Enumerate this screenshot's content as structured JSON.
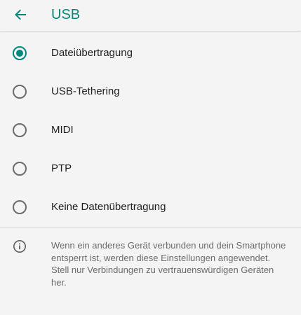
{
  "header": {
    "back_icon": "arrow-left-icon",
    "title": "USB"
  },
  "usb_options": {
    "selected": "Dateiübertragung",
    "items": [
      {
        "label": "Dateiübertragung",
        "checked": true
      },
      {
        "label": "USB-Tethering",
        "checked": false
      },
      {
        "label": "MIDI",
        "checked": false
      },
      {
        "label": "PTP",
        "checked": false
      },
      {
        "label": "Keine Datenübertragung",
        "checked": false
      }
    ]
  },
  "info": {
    "icon": "info-icon",
    "text": "Wenn ein anderes Gerät verbunden und dein Smartphone entsperrt ist, werden diese Einstellungen angewendet. Stell nur Verbindungen zu vertrauenswürdigen Geräten her."
  },
  "colors": {
    "accent": "#00897b",
    "background": "#f4f4f4",
    "text_primary": "#1f1f1f",
    "text_secondary": "#6b6b6b"
  }
}
